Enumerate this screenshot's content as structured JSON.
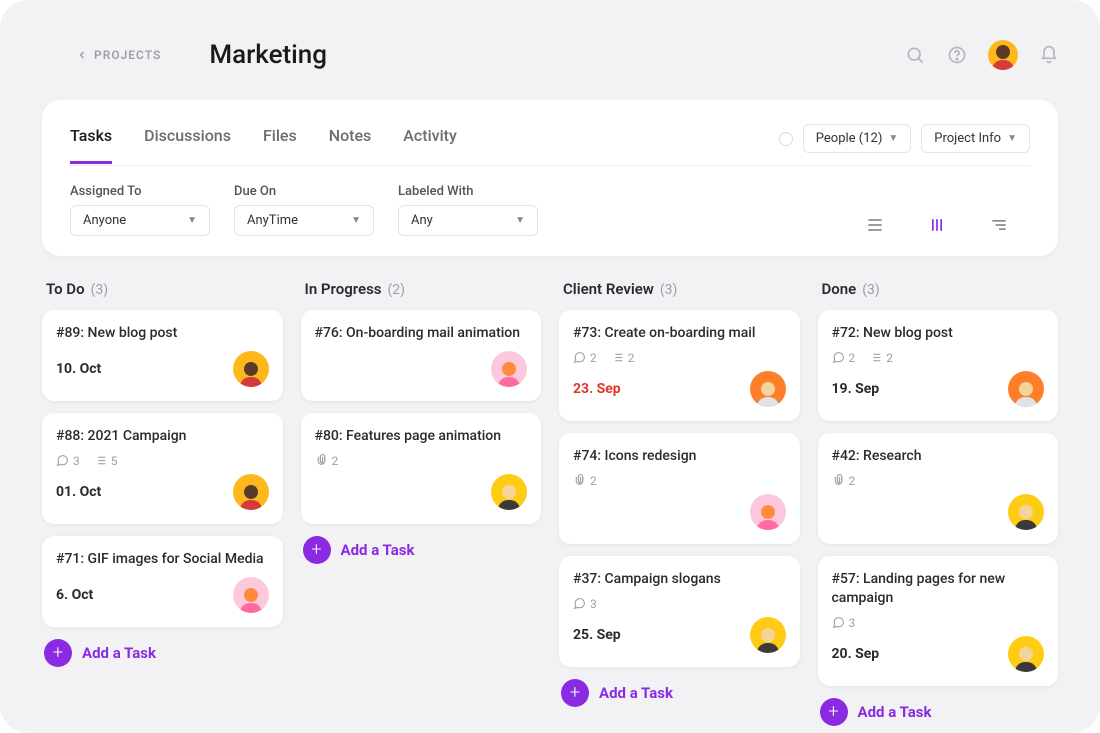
{
  "header": {
    "back_label": "PROJECTS",
    "title": "Marketing",
    "people_label": "People (12)",
    "info_label": "Project Info"
  },
  "tabs": [
    {
      "label": "Tasks",
      "active": true
    },
    {
      "label": "Discussions",
      "active": false
    },
    {
      "label": "Files",
      "active": false
    },
    {
      "label": "Notes",
      "active": false
    },
    {
      "label": "Activity",
      "active": false
    }
  ],
  "filters": {
    "assigned": {
      "label": "Assigned To",
      "value": "Anyone"
    },
    "due": {
      "label": "Due On",
      "value": "AnyTime"
    },
    "labeled": {
      "label": "Labeled With",
      "value": "Any"
    }
  },
  "add_task_label": "Add a Task",
  "columns": [
    {
      "key": "todo",
      "title": "To Do",
      "count": "(3)",
      "cards": [
        {
          "title": "#89: New blog post",
          "date": "10. Oct",
          "avatar": "brown"
        },
        {
          "title": "#88: 2021 Campaign",
          "comments": "3",
          "subtasks": "5",
          "date": "01. Oct",
          "avatar": "brown"
        },
        {
          "title": "#71: GIF images for Social Media",
          "date": "6. Oct",
          "avatar": "pink"
        }
      ],
      "show_add": true
    },
    {
      "key": "progress",
      "title": "In Progress",
      "count": "(2)",
      "cards": [
        {
          "title": "#76: On-boarding mail animation",
          "avatar": "pink"
        },
        {
          "title": "#80: Features page animation",
          "attachments": "2",
          "avatar": "yellow"
        }
      ],
      "show_add": true
    },
    {
      "key": "review",
      "title": "Client Review",
      "count": "(3)",
      "cards": [
        {
          "title": "#73: Create on-boarding mail",
          "comments": "2",
          "subtasks": "2",
          "date": "23. Sep",
          "overdue": true,
          "avatar": "orange"
        },
        {
          "title": "#74: Icons redesign",
          "attachments": "2",
          "avatar": "pink"
        },
        {
          "title": "#37: Campaign slogans",
          "comments": "3",
          "date": "25. Sep",
          "avatar": "yellow"
        }
      ],
      "show_add": true
    },
    {
      "key": "done",
      "title": "Done",
      "count": "(3)",
      "cards": [
        {
          "title": "#72: New blog post",
          "comments": "2",
          "subtasks": "2",
          "date": "19. Sep",
          "avatar": "orange"
        },
        {
          "title": "#42: Research",
          "attachments": "2",
          "avatar": "yellow"
        },
        {
          "title": "#57: Landing pages for new campaign",
          "comments": "3",
          "date": "20. Sep",
          "avatar": "yellow"
        }
      ],
      "show_add": true
    }
  ]
}
